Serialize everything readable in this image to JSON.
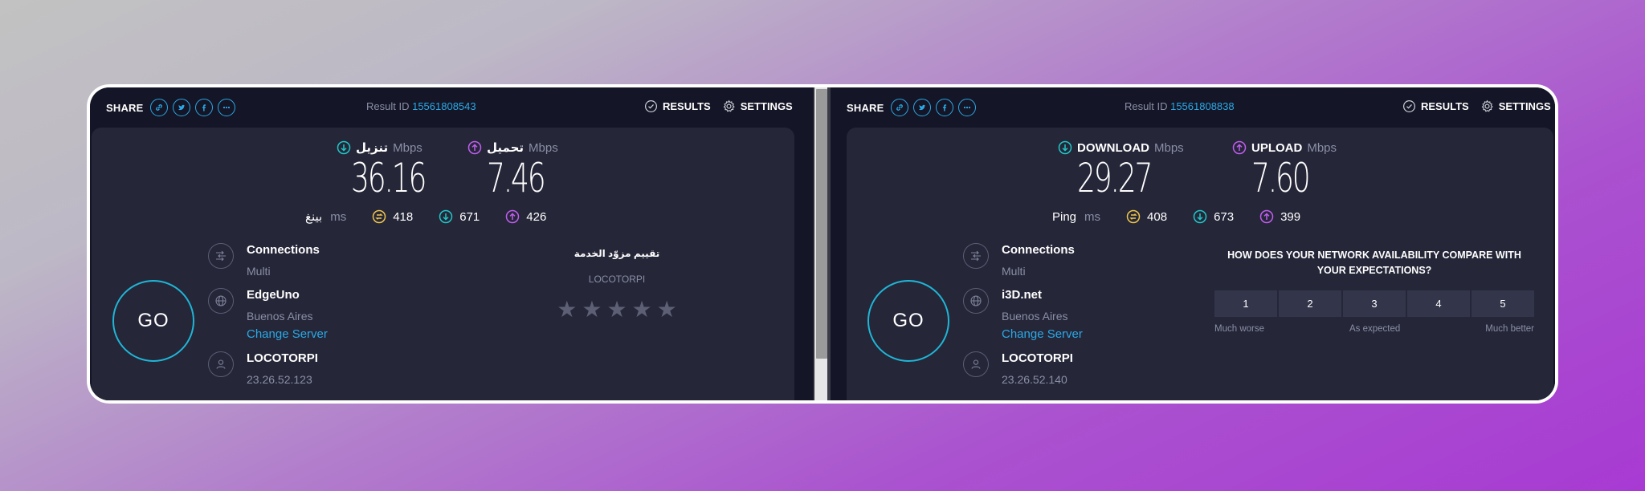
{
  "left": {
    "share_label": "SHARE",
    "result_id_label": "Result ID",
    "result_id": "15561808543",
    "results_label": "RESULTS",
    "settings_label": "SETTINGS",
    "download_label": "تنزيل",
    "upload_label": "تحميل",
    "speed_unit": "Mbps",
    "download_value": "36.16",
    "upload_value": "7.46",
    "ping_label": "بينغ",
    "ping_unit": "ms",
    "ping_idle": "418",
    "ping_download": "671",
    "ping_upload": "426",
    "go_label": "GO",
    "connections_title": "Connections",
    "connections_value": "Multi",
    "server_name": "EdgeUno",
    "server_location": "Buenos Aires",
    "change_server": "Change Server",
    "isp_name": "LOCOTORPI",
    "ip_address": "23.26.52.123",
    "rating_title": "تقييم مزوّد الخدمة",
    "rating_isp": "LOCOTORPI",
    "stars": [
      "★",
      "★",
      "★",
      "★",
      "★"
    ]
  },
  "right": {
    "share_label": "SHARE",
    "result_id_label": "Result ID",
    "result_id": "15561808838",
    "results_label": "RESULTS",
    "settings_label": "SETTINGS",
    "download_label": "DOWNLOAD",
    "upload_label": "UPLOAD",
    "speed_unit": "Mbps",
    "download_value": "29.27",
    "upload_value": "7.60",
    "ping_label": "Ping",
    "ping_unit": "ms",
    "ping_idle": "408",
    "ping_download": "673",
    "ping_upload": "399",
    "go_label": "GO",
    "connections_title": "Connections",
    "connections_value": "Multi",
    "server_name": "i3D.net",
    "server_location": "Buenos Aires",
    "change_server": "Change Server",
    "isp_name": "LOCOTORPI",
    "ip_address": "23.26.52.140",
    "survey_question": "HOW DOES YOUR NETWORK AVAILABILITY COMPARE WITH YOUR EXPECTATIONS?",
    "scale": [
      "1",
      "2",
      "3",
      "4",
      "5"
    ],
    "scale_low": "Much worse",
    "scale_mid": "As expected",
    "scale_high": "Much better"
  },
  "colors": {
    "accent_blue": "#2aa9e6",
    "download_teal": "#1fc8c8",
    "upload_purple": "#c25df0",
    "ping_yellow": "#f0c64a",
    "go_ring": "#1fb6d6"
  },
  "icons": {
    "share": [
      "link-icon",
      "twitter-icon",
      "facebook-icon",
      "more-icon"
    ],
    "results": "check-circle-icon",
    "settings": "gear-icon",
    "download": "arrow-down-circle-icon",
    "upload": "arrow-up-circle-icon",
    "ping": "jitter-icon",
    "connections": "connections-icon",
    "server": "globe-icon",
    "isp": "user-icon"
  }
}
